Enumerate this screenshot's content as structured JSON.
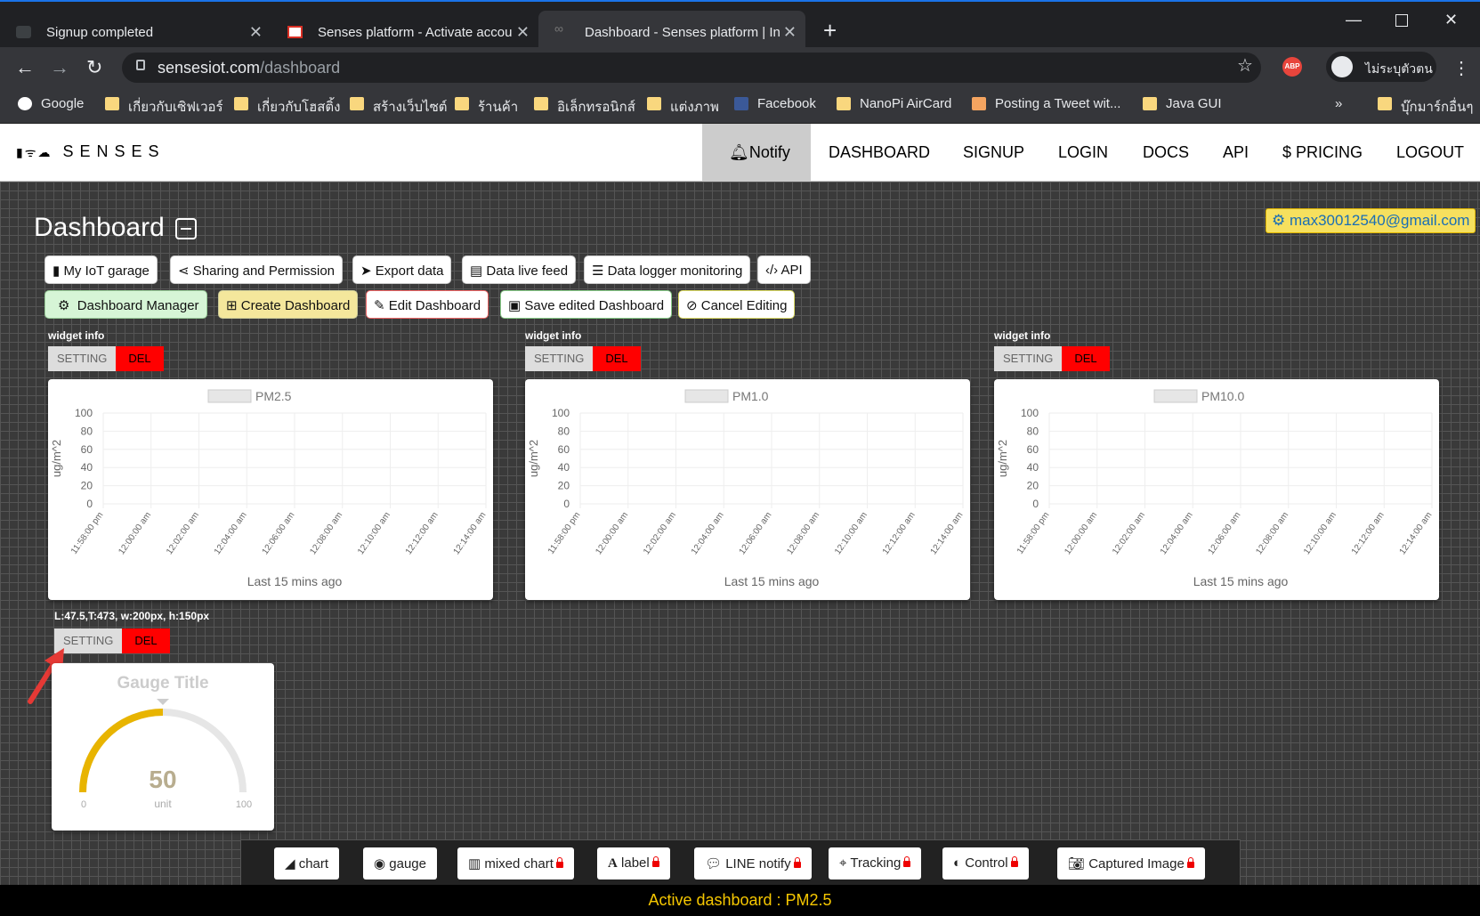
{
  "browser": {
    "tabs": [
      {
        "title": "Signup completed"
      },
      {
        "title": "Senses platform - Activate accou"
      },
      {
        "title": "Dashboard - Senses platform | In"
      }
    ],
    "url_host": "sensesiot.com",
    "url_path": "/dashboard",
    "profile_label": "ไม่ระบุตัวตน",
    "abp": "ABP",
    "bookmarks": [
      "Google",
      "เกี่ยวกับเซิฟเวอร์",
      "เกี่ยวกับโฮสติ้ง",
      "สร้างเว็บไซต์",
      "ร้านค้า",
      "อิเล็กทรอนิกส์",
      "แต่งภาพ",
      "Facebook",
      "NanoPi AirCard",
      "Posting a Tweet wit...",
      "Java GUI"
    ],
    "more_bookmarks": "»",
    "other_bookmarks": "บุ๊กมาร์กอื่นๆ"
  },
  "site": {
    "logo": "SENSES",
    "nav": [
      "Notify",
      "DASHBOARD",
      "SIGNUP",
      "LOGIN",
      "DOCS",
      "API",
      "$ PRICING",
      "LOGOUT"
    ]
  },
  "dashboard": {
    "title": "Dashboard",
    "user_email": "max30012540@gmail.com",
    "row1_buttons": [
      "My IoT garage",
      "Sharing and Permission",
      "Export data",
      "Data live feed",
      "Data logger monitoring",
      "API"
    ],
    "row2_buttons": [
      "Dashboard Manager",
      "Create Dashboard",
      "Edit Dashboard",
      "Save edited Dashboard",
      "Cancel Editing"
    ],
    "widget_info": "widget info",
    "setting": "SETTING",
    "del": "DEL",
    "gauge_info": "L:47.5,T:473, w:200px, h:150px",
    "gauge": {
      "title": "Gauge Title",
      "value": 50,
      "min": 0,
      "max": 100,
      "unit": "unit",
      "color": "#e8b400"
    },
    "palette": [
      "chart",
      "gauge",
      "mixed chart",
      "label",
      "LINE notify",
      "Tracking",
      "Control",
      "Captured Image"
    ],
    "active": "Active dashboard : PM2.5"
  },
  "chart_data": [
    {
      "type": "line",
      "title": "PM2.5",
      "ylabel": "ug/m^2",
      "xlabel": "Last 15 mins ago",
      "ylim": [
        0,
        100
      ],
      "yticks": [
        0,
        20,
        40,
        60,
        80,
        100
      ],
      "categories": [
        "11:58:00 pm",
        "12:00:00 am",
        "12:02:00 am",
        "12:04:00 am",
        "12:06:00 am",
        "12:08:00 am",
        "12:10:00 am",
        "12:12:00 am",
        "12:14:00 am"
      ],
      "series": [
        {
          "name": "PM2.5",
          "values": []
        }
      ]
    },
    {
      "type": "line",
      "title": "PM1.0",
      "ylabel": "ug/m^2",
      "xlabel": "Last 15 mins ago",
      "ylim": [
        0,
        100
      ],
      "yticks": [
        0,
        20,
        40,
        60,
        80,
        100
      ],
      "categories": [
        "11:58:00 pm",
        "12:00:00 am",
        "12:02:00 am",
        "12:04:00 am",
        "12:06:00 am",
        "12:08:00 am",
        "12:10:00 am",
        "12:12:00 am",
        "12:14:00 am"
      ],
      "series": [
        {
          "name": "PM1.0",
          "values": []
        }
      ]
    },
    {
      "type": "line",
      "title": "PM10.0",
      "ylabel": "ug/m^2",
      "xlabel": "Last 15 mins ago",
      "ylim": [
        0,
        100
      ],
      "yticks": [
        0,
        20,
        40,
        60,
        80,
        100
      ],
      "categories": [
        "11:58:00 pm",
        "12:00:00 am",
        "12:02:00 am",
        "12:04:00 am",
        "12:06:00 am",
        "12:08:00 am",
        "12:10:00 am",
        "12:12:00 am",
        "12:14:00 am"
      ],
      "series": [
        {
          "name": "PM10.0",
          "values": []
        }
      ]
    }
  ]
}
